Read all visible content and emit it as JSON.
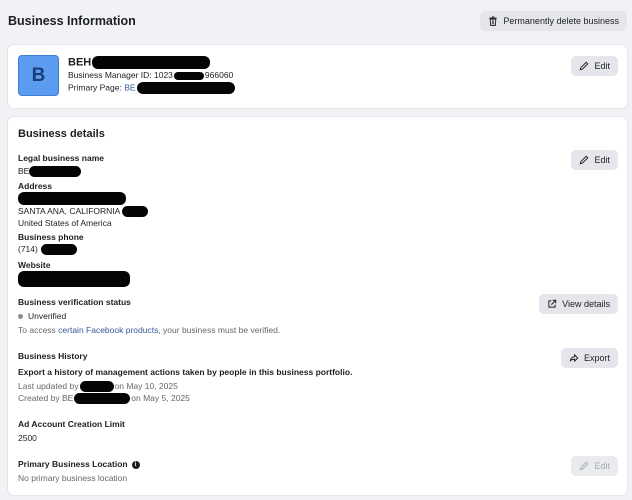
{
  "header": {
    "title": "Business Information",
    "delete_label": "Permanently delete business"
  },
  "summary": {
    "avatar_letter": "B",
    "name": "BEH",
    "manager_id_label": "Business Manager ID: 1023",
    "manager_id_suffix": "966060",
    "primary_page_label": "Primary Page: ",
    "primary_page_link": "BE",
    "edit_label": "Edit"
  },
  "details": {
    "title": "Business details",
    "edit_label": "Edit",
    "legal_name_label": "Legal business name",
    "legal_name_value": "BE",
    "address_label": "Address",
    "address_city": "SANTA ANA, CALIFORNIA",
    "address_country": "United States of America",
    "phone_label": "Business phone",
    "phone_value": "(714)",
    "website_label": "Website",
    "verification_label": "Business verification status",
    "verification_status": "Unverified",
    "verification_note_pre": "To access ",
    "verification_note_link": "certain Facebook products",
    "verification_note_post": ", your business must be verified.",
    "view_details_label": "View details",
    "history_label": "Business History",
    "history_desc": "Export a history of management actions taken by people in this business portfolio.",
    "history_updated_pre": "Last updated by",
    "history_updated_post": "on May 10, 2025",
    "history_created_pre": "Created by BE",
    "history_created_post": "on May 5, 2025",
    "export_label": "Export",
    "ad_limit_label": "Ad Account Creation Limit",
    "ad_limit_value": "2500",
    "location_label": "Primary Business Location",
    "location_value": "No primary business location",
    "location_edit_label": "Edit"
  }
}
